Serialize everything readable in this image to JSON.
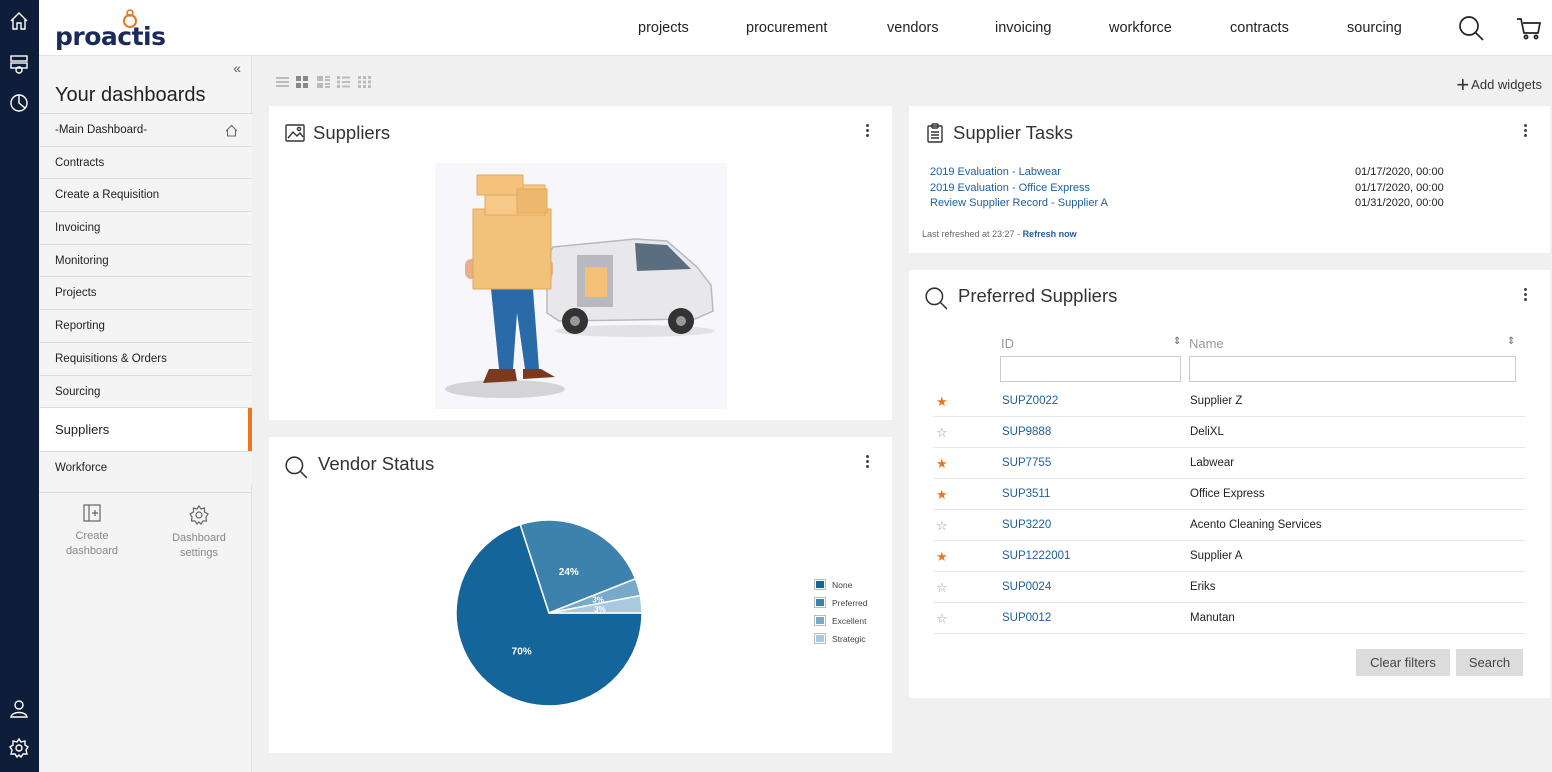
{
  "brand": {
    "name": "proactis",
    "accent": "#e87722",
    "primary": "#1f5fa0",
    "rail": "#0e1e3a"
  },
  "rail_icons": [
    "home-icon",
    "inbox-icon",
    "clock-icon",
    "user-icon",
    "settings-icon"
  ],
  "nav": {
    "items": [
      "projects",
      "procurement",
      "vendors",
      "invoicing",
      "workforce",
      "contracts",
      "sourcing"
    ]
  },
  "sidebar": {
    "collapse": "«",
    "title": "Your dashboards",
    "items": [
      {
        "label": "-Main Dashboard-"
      },
      {
        "label": "Contracts"
      },
      {
        "label": "Create a Requisition"
      },
      {
        "label": "Invoicing"
      },
      {
        "label": "Monitoring"
      },
      {
        "label": "Projects"
      },
      {
        "label": "Reporting"
      },
      {
        "label": "Requisitions & Orders"
      },
      {
        "label": "Sourcing"
      },
      {
        "label": "Suppliers"
      },
      {
        "label": "Workforce"
      }
    ],
    "actions": {
      "create_line1": "Create",
      "create_line2": "dashboard",
      "settings_line1": "Dashboard",
      "settings_line2": "settings"
    }
  },
  "toolbar": {
    "add_widgets": "Add widgets"
  },
  "widgets": {
    "suppliers": {
      "title": "Suppliers"
    },
    "vendor_status": {
      "title": "Vendor Status"
    },
    "supplier_tasks": {
      "title": "Supplier Tasks",
      "tasks": [
        {
          "name": "2019 Evaluation - Labwear",
          "date": "01/17/2020, 00:00"
        },
        {
          "name": "2019 Evaluation - Office Express",
          "date": "01/17/2020, 00:00"
        },
        {
          "name": "Review Supplier Record - Supplier A",
          "date": "01/31/2020, 00:00"
        }
      ],
      "refreshed": "Last refreshed at 23:27 - ",
      "refresh_link": "Refresh now"
    },
    "preferred": {
      "title": "Preferred Suppliers",
      "col_id": "ID",
      "col_name": "Name",
      "rows": [
        {
          "id": "SUPZ0022",
          "name": "Supplier Z",
          "star": "★"
        },
        {
          "id": "SUP9888",
          "name": "DeliXL",
          "star": "☆"
        },
        {
          "id": "SUP7755",
          "name": "Labwear",
          "star": "★"
        },
        {
          "id": "SUP3511",
          "name": "Office Express",
          "star": "★"
        },
        {
          "id": "SUP3220",
          "name": "Acento Cleaning Services",
          "star": "☆"
        },
        {
          "id": "SUP1222001",
          "name": "Supplier A",
          "star": "★"
        },
        {
          "id": "SUP0024",
          "name": "Eriks",
          "star": "☆"
        },
        {
          "id": "SUP0012",
          "name": "Manutan",
          "star": "☆"
        }
      ],
      "clear_label": "Clear filters",
      "search_label": "Search"
    }
  },
  "chart_data": {
    "type": "pie",
    "title": "",
    "categories": [
      "None",
      "Preferred",
      "Excellent",
      "Strategic"
    ],
    "values": [
      70,
      24,
      3,
      3
    ],
    "labels": [
      "70%",
      "24%",
      "3%",
      "3%"
    ],
    "colors": [
      "#13659a",
      "#3d82ac",
      "#78a9c8",
      "#a8c9de"
    ],
    "legend": "right"
  }
}
